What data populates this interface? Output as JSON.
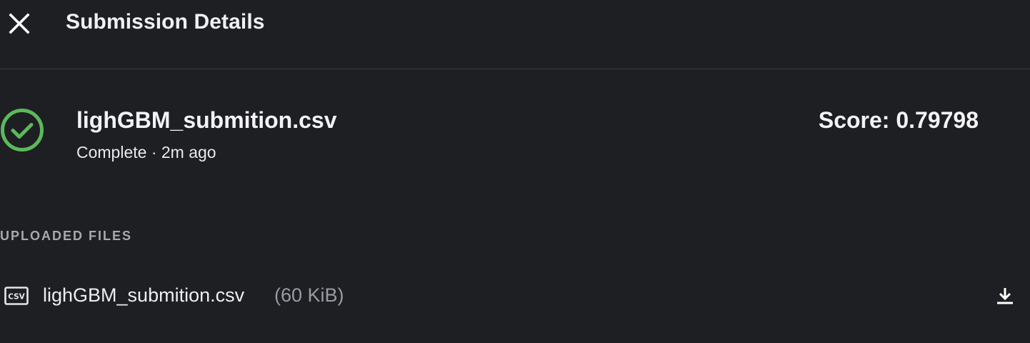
{
  "header": {
    "title": "Submission Details",
    "close_icon": "close-icon"
  },
  "submission": {
    "file_name": "lighGBM_submition.csv",
    "status": "Complete",
    "separator": "·",
    "time_ago": "2m ago",
    "status_line": "Complete · 2m ago",
    "score_label": "Score: 0.79798",
    "score_value": "0.79798",
    "status_icon": "check-circle-icon",
    "status_color": "#5cb85c"
  },
  "uploaded_files": {
    "label": "UPLOADED FILES",
    "files": [
      {
        "name": "lighGBM_submition.csv",
        "size": "(60 KiB)",
        "icon": "csv-file-icon",
        "action_icon": "download-icon"
      }
    ]
  }
}
